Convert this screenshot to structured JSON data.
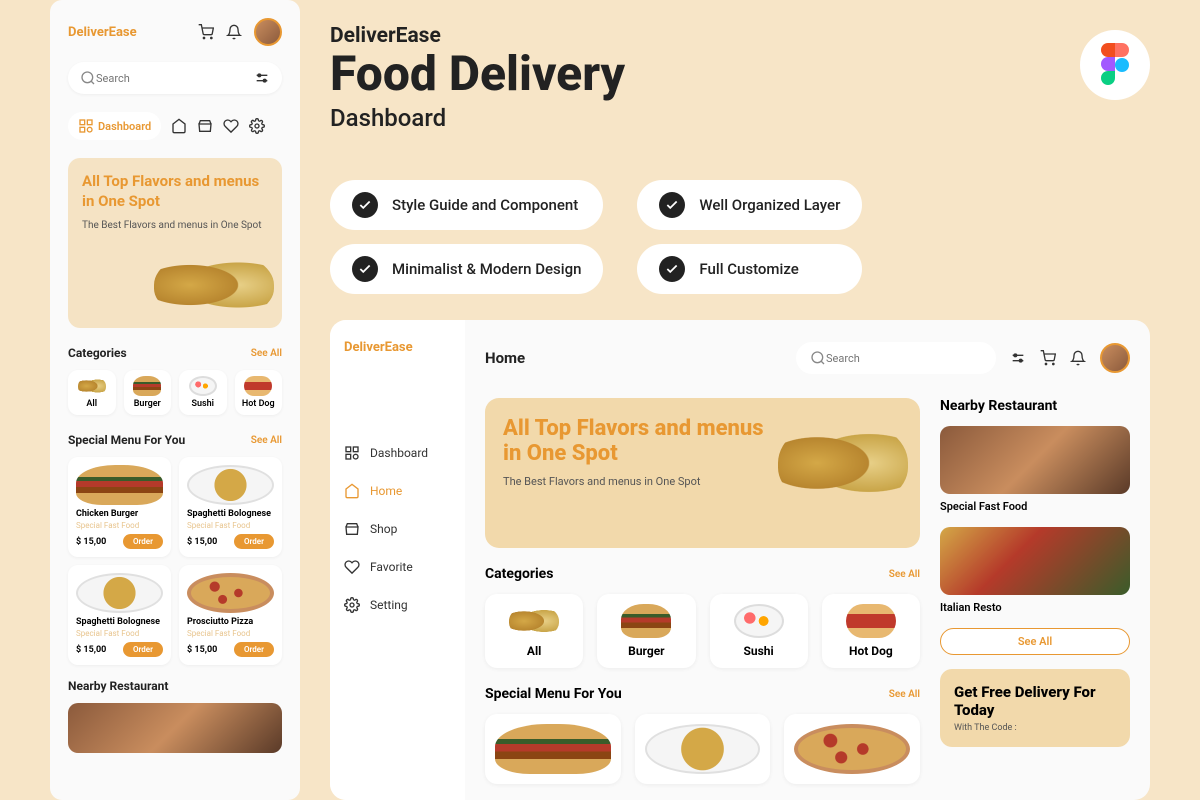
{
  "brand": "DeliverEase",
  "hero": {
    "brand": "DeliverEase",
    "title": "Food Delivery",
    "subtitle": "Dashboard"
  },
  "features": [
    "Style Guide and Component",
    "Well Organized Layer",
    "Minimalist & Modern Design",
    "Full Customize"
  ],
  "search": {
    "placeholder": "Search"
  },
  "leftPanel": {
    "navActive": "Dashboard",
    "hero": {
      "title": "All Top Flavors and menus in One Spot",
      "subtitle": "The Best Flavors and menus in One Spot"
    },
    "categories": {
      "title": "Categories",
      "seeAll": "See All",
      "items": [
        "All",
        "Burger",
        "Sushi",
        "Hot Dog"
      ]
    },
    "specialMenu": {
      "title": "Special Menu For You",
      "seeAll": "See All",
      "items": [
        {
          "name": "Chicken Burger",
          "category": "Special Fast Food",
          "price": "$ 15,00",
          "button": "Order"
        },
        {
          "name": "Spaghetti Bolognese",
          "category": "Special Fast Food",
          "price": "$ 15,00",
          "button": "Order"
        },
        {
          "name": "Spaghetti Bolognese",
          "category": "Special Fast Food",
          "price": "$ 15,00",
          "button": "Order"
        },
        {
          "name": "Prosciutto Pizza",
          "category": "Special Fast Food",
          "price": "$ 15,00",
          "button": "Order"
        }
      ]
    },
    "nearby": {
      "title": "Nearby Restaurant"
    }
  },
  "dashboard": {
    "pageTitle": "Home",
    "nav": [
      "Dashboard",
      "Home",
      "Shop",
      "Favorite",
      "Setting"
    ],
    "hero": {
      "title": "All Top Flavors and menus in One Spot",
      "subtitle": "The Best Flavors and menus in One Spot"
    },
    "categories": {
      "title": "Categories",
      "seeAll": "See All",
      "items": [
        "All",
        "Burger",
        "Sushi",
        "Hot Dog"
      ]
    },
    "specialMenu": {
      "title": "Special Menu For You",
      "seeAll": "See All"
    },
    "nearby": {
      "title": "Nearby Restaurant",
      "items": [
        "Special Fast Food",
        "Italian Resto"
      ],
      "seeAll": "See All"
    },
    "promo": {
      "title": "Get Free Delivery For Today",
      "subtitle": "With The Code :"
    }
  },
  "colors": {
    "accent": "#e89832",
    "bg": "#f7e5c7",
    "heroBg": "#f2d9ab"
  }
}
